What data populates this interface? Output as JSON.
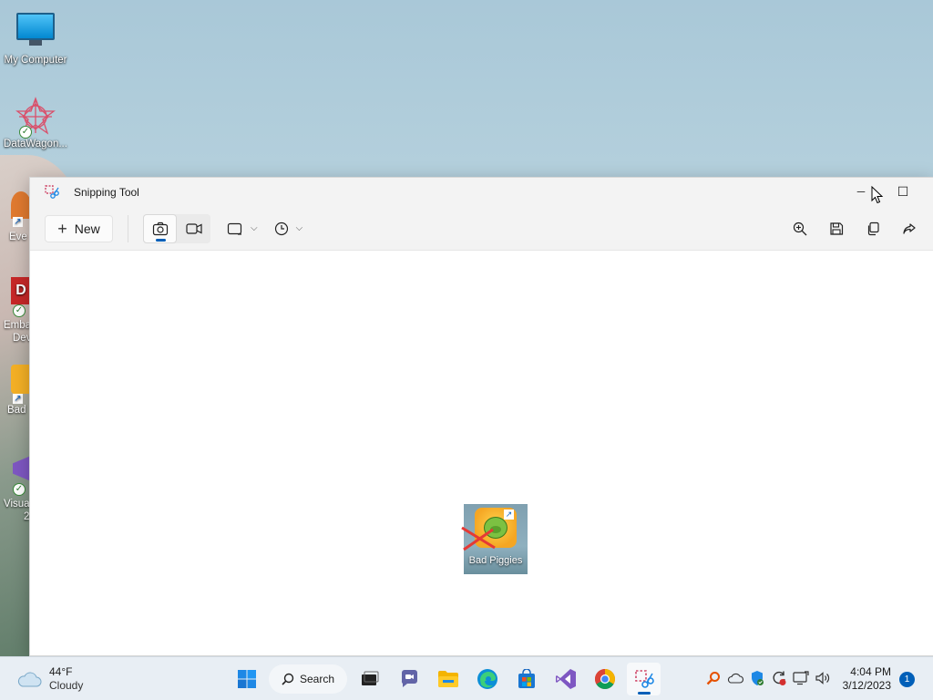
{
  "desktop": {
    "icons": [
      {
        "label": "My Computer"
      },
      {
        "label": "DataWagon..."
      }
    ],
    "partial_labels": [
      "Eve",
      "Emba",
      "Dev",
      "Bad",
      "Visua",
      "2"
    ]
  },
  "window": {
    "title": "Snipping Tool",
    "controls": {
      "minimize": "─",
      "maximize": "☐"
    },
    "toolbar": {
      "new_label": "New",
      "modes": [
        {
          "name": "snip-mode",
          "active": true
        },
        {
          "name": "record-mode",
          "active": false
        }
      ]
    },
    "canvas": {
      "thumbnail_label": "Bad Piggies"
    }
  },
  "taskbar": {
    "weather": {
      "temp": "44°F",
      "condition": "Cloudy"
    },
    "search_label": "Search",
    "clock": {
      "time": "4:04 PM",
      "date": "3/12/2023"
    },
    "notification_count": "1"
  },
  "colors": {
    "accent": "#005fb8",
    "window_bg": "#f3f3f3",
    "taskbar_bg": "#e8eef4"
  }
}
